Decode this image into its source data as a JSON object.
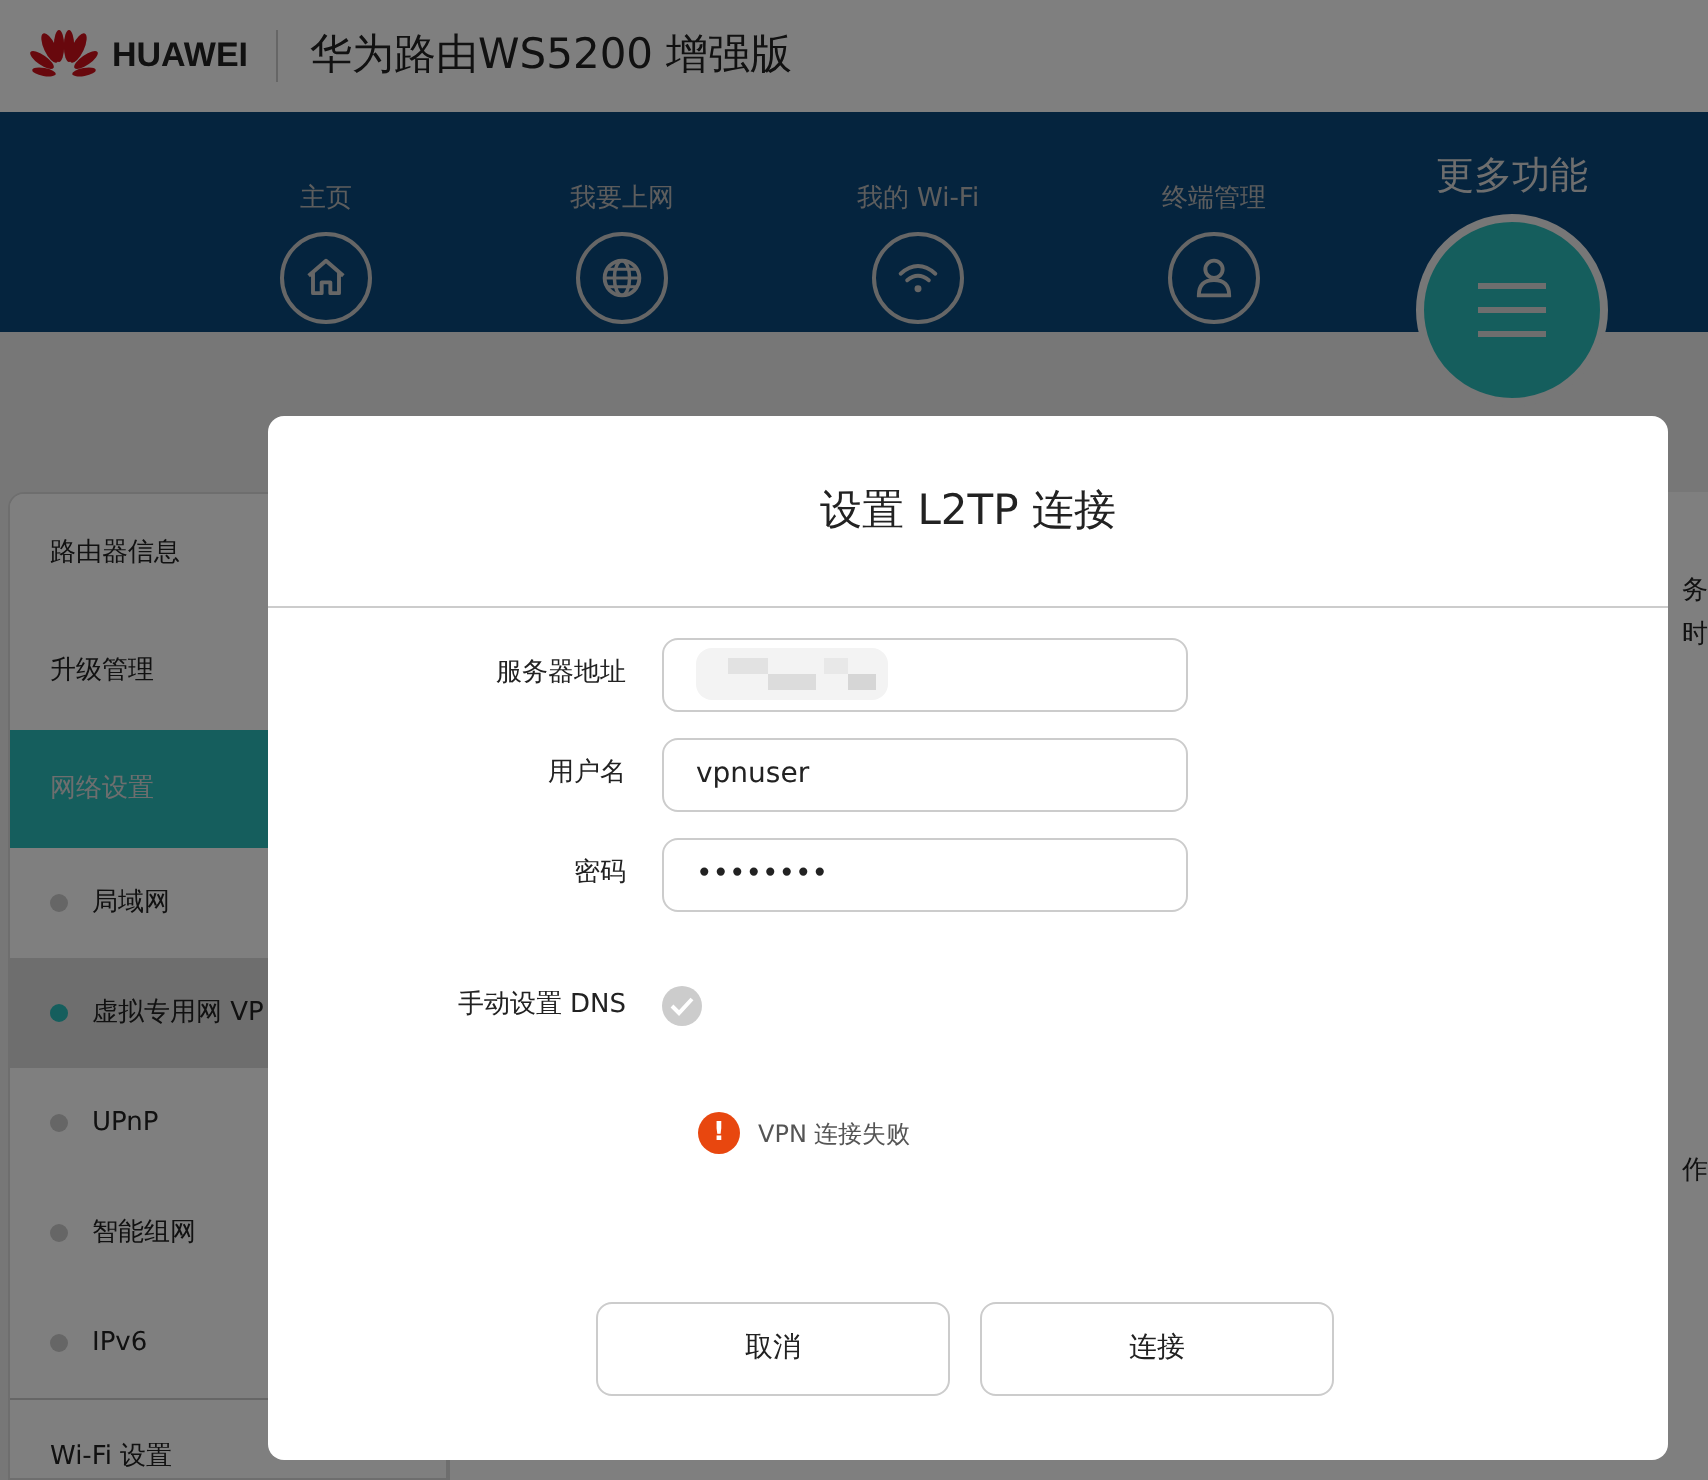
{
  "header": {
    "brand": "HUAWEI",
    "title": "华为路由WS5200 增强版"
  },
  "nav": {
    "items": [
      {
        "label": "主页"
      },
      {
        "label": "我要上网"
      },
      {
        "label": "我的 Wi-Fi"
      },
      {
        "label": "终端管理"
      }
    ],
    "more": {
      "label": "更多功能"
    }
  },
  "sidebar": {
    "items": [
      {
        "label": "路由器信息",
        "kind": "group",
        "selected": false
      },
      {
        "label": "升级管理",
        "kind": "group",
        "selected": false
      },
      {
        "label": "网络设置",
        "kind": "group",
        "selected": true
      },
      {
        "label": "局域网",
        "kind": "sub",
        "selected": false
      },
      {
        "label": "虚拟专用网 VP",
        "kind": "sub",
        "selected": true
      },
      {
        "label": "UPnP",
        "kind": "sub",
        "selected": false
      },
      {
        "label": "智能组网",
        "kind": "sub",
        "selected": false
      },
      {
        "label": "IPv6",
        "kind": "sub",
        "selected": false
      },
      {
        "label": "Wi-Fi 设置",
        "kind": "group",
        "selected": false
      }
    ]
  },
  "background_texts": [
    "务",
    "时",
    "作"
  ],
  "dialog": {
    "title": "设置 L2TP 连接",
    "fields": [
      {
        "label": "服务器地址",
        "kind": "redacted"
      },
      {
        "label": "用户名",
        "kind": "text",
        "value": "vpnuser"
      },
      {
        "label": "密码",
        "kind": "text",
        "value": "••••••••"
      }
    ],
    "dns": {
      "label": "手动设置 DNS",
      "checked": true
    },
    "error": {
      "icon": "!",
      "text": "VPN 连接失败"
    },
    "buttons": [
      "取消",
      "连接"
    ]
  }
}
